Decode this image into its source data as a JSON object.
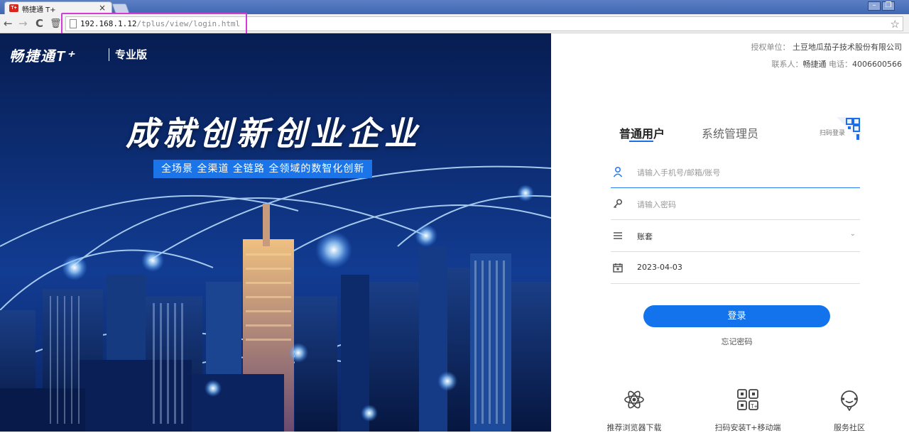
{
  "browser": {
    "tab_title": "畅捷通 T+",
    "tab_close": "×",
    "address_host": "192.168.1.12",
    "address_path": "/tplus/view/login.html",
    "nav_back": "←",
    "nav_forward": "→",
    "nav_reload": "C",
    "nav_delete": "🗑",
    "window_controls": [
      "–",
      "❐"
    ]
  },
  "banner": {
    "brand": "畅捷通T⁺",
    "edition": "专业版",
    "headline": "成就创新创业企业",
    "subline": "全场景 全渠道 全链路 全领域的数智化创新"
  },
  "panel": {
    "license_label": "授权单位：",
    "license_value": "土豆地瓜茄子技术股份有限公司",
    "contact_label": "联系人：",
    "contact_value": "畅捷通",
    "phone_label": "电话：",
    "phone_value": "4006600566",
    "tabs": {
      "user": "普通用户",
      "admin": "系统管理员",
      "qr": "扫码登录"
    },
    "fields": {
      "account_placeholder": "请输入手机号/邮箱/账号",
      "password_placeholder": "请输入密码",
      "set_of_books": "账套",
      "date": "2023-04-03"
    },
    "login_button": "登录",
    "forgot_password": "忘记密码",
    "footer": {
      "browser_download": "推荐浏览器下载",
      "mobile_install": "扫码安装T+移动端",
      "community": "服务社区"
    }
  },
  "colors": {
    "accent": "#1273ec",
    "highlight_border": "#d23bd6",
    "banner_bg": "#0c2a6e"
  }
}
